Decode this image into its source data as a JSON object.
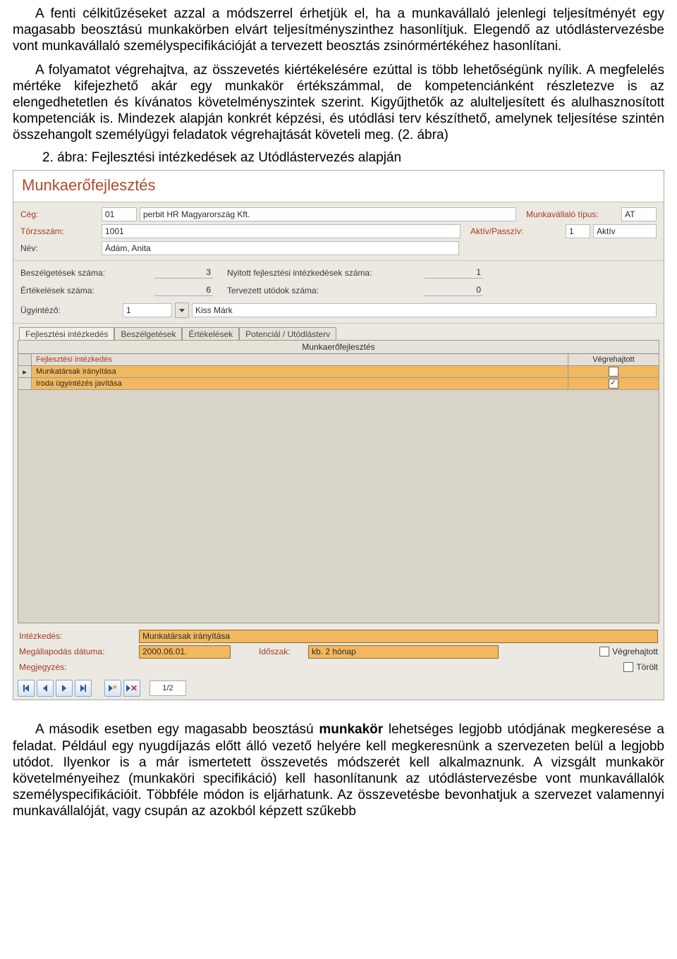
{
  "text": {
    "para1": "A fenti célkitűzéseket azzal a módszerrel érhetjük el, ha a munkavállaló jelenlegi teljesítményét egy magasabb beosztású munkakörben elvárt teljesítményszinthez hasonlítjuk. Elegendő az utódlástervezésbe vont munkavállaló személyspecifikációját a tervezett beosztás zsinórmértékéhez hasonlítani.",
    "para2": "A folyamatot végrehajtva, az összevetés kiértékelésére ezúttal is több lehetőségünk nyílik. A megfelelés mértéke kifejezhető akár egy munkakör értékszámmal, de kompetenciánként részletezve is az elengedhetetlen és kívánatos követelményszintek szerint. Kigyűjthetők az alulteljesített és alulhasznosított kompetenciák is. Mindezek alapján konkrét képzési, és utódlási terv készíthető, amelynek teljesítése szintén összehangolt személyügyi feladatok végrehajtását követeli meg. (2. ábra)",
    "caption": "2. ábra: Fejlesztési intézkedések az Utódlástervezés alapján",
    "para3a": "A második esetben egy magasabb beosztású ",
    "para3b": "munkakör",
    "para3c": " lehetséges legjobb utódjának megkeresése a feladat. Például egy nyugdíjazás előtt álló vezető helyére kell megkeresnünk a szervezeten belül a legjobb utódot. Ilyenkor is a már ismertetett összevetés módszerét kell alkalmaznunk. A vizsgált munkakör követelményeihez (munkaköri specifikáció) kell hasonlítanunk az utódlástervezésbe vont munkavállalók személyspecifikációit. Többféle módon is eljárhatunk. Az összevetésbe bevonhatjuk a szervezet valamennyi munkavállalóját, vagy csupán az azokból képzett szűkebb"
  },
  "ui": {
    "title": "Munkaerőfejlesztés",
    "header": {
      "ceg_label": "Cég:",
      "ceg_code": "01",
      "ceg_name": "perbit HR Magyarország Kft.",
      "tipus_label": "Munkavállaló típus:",
      "tipus_value": "AT",
      "torzs_label": "Törzsszám:",
      "torzs_value": "1001",
      "status_label": "Aktív/Passzív:",
      "status_code": "1",
      "status_text": "Aktív",
      "nev_label": "Név:",
      "nev_value": "Ádám, Anita"
    },
    "counts": {
      "c1_label": "Beszélgetések száma:",
      "c1_value": "3",
      "c2_label": "Nyitott fejlesztési intézkedések száma:",
      "c2_value": "1",
      "c3_label": "Értékelések száma:",
      "c3_value": "6",
      "c4_label": "Tervezett utódok száma:",
      "c4_value": "0",
      "ugy_label": "Ügyintéző:",
      "ugy_code": "1",
      "ugy_name": "Kiss Márk"
    },
    "tabs": {
      "t1": "Fejlesztési intézkedés",
      "t2": "Beszélgetések",
      "t3": "Értékelések",
      "t4": "Potenciál / Utódlásterv"
    },
    "grid": {
      "title": "Munkaerőfejlesztés",
      "h1": "Fejlesztési intézkedés",
      "h2": "Végrehajtott",
      "r1": "Munkatársak irányítása",
      "r2": "Iroda ügyintézés javítása"
    },
    "detail": {
      "intezkedes_label": "Intézkedés:",
      "intezkedes_value": "Munkatársak irányítása",
      "megall_label": "Megállapodás dátuma:",
      "megall_value": "2000.06.01.",
      "idoszak_label": "Időszak:",
      "idoszak_value": "kb. 2 hónap",
      "vegre_label": "Végrehajtott",
      "megj_label": "Megjegyzés:",
      "torolt_label": "Törölt"
    },
    "nav": {
      "count": "1/2"
    }
  }
}
